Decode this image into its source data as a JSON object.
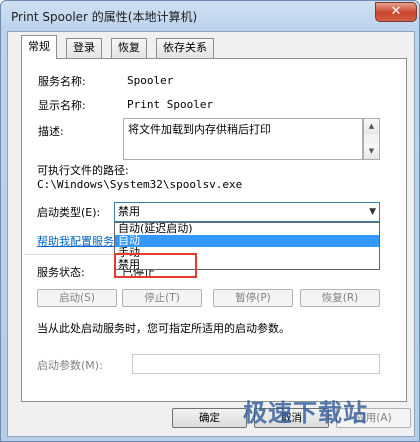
{
  "window": {
    "title": "Print Spooler 的属性(本地计算机)",
    "close_label": "✕"
  },
  "tabs": [
    {
      "label": "常规",
      "active": true
    },
    {
      "label": "登录",
      "active": false
    },
    {
      "label": "恢复",
      "active": false
    },
    {
      "label": "依存关系",
      "active": false
    }
  ],
  "general": {
    "service_name_label": "服务名称:",
    "service_name_value": "Spooler",
    "display_name_label": "显示名称:",
    "display_name_value": "Print Spooler",
    "description_label": "描述:",
    "description_value": "将文件加载到内存供稍后打印",
    "path_label": "可执行文件的路径:",
    "path_value": "C:\\Windows\\System32\\spoolsv.exe",
    "startup_type_label": "启动类型(E):",
    "startup_type_selected": "禁用",
    "startup_options": [
      "自动(延迟启动)",
      "自动",
      "手动",
      "禁用"
    ],
    "help_link": "帮助我配置服务",
    "status_label": "服务状态:",
    "status_value": "已停止",
    "buttons": {
      "start": "启动(S)",
      "stop": "停止(T)",
      "pause": "暂停(P)",
      "resume": "恢复(R)"
    },
    "hint_text": "当从此处启动服务时，您可指定所适用的启动参数。",
    "param_label": "启动参数(M):"
  },
  "footer": {
    "ok": "确定",
    "cancel": "取消",
    "apply": "应用(A)"
  },
  "watermark": "极速下载站"
}
